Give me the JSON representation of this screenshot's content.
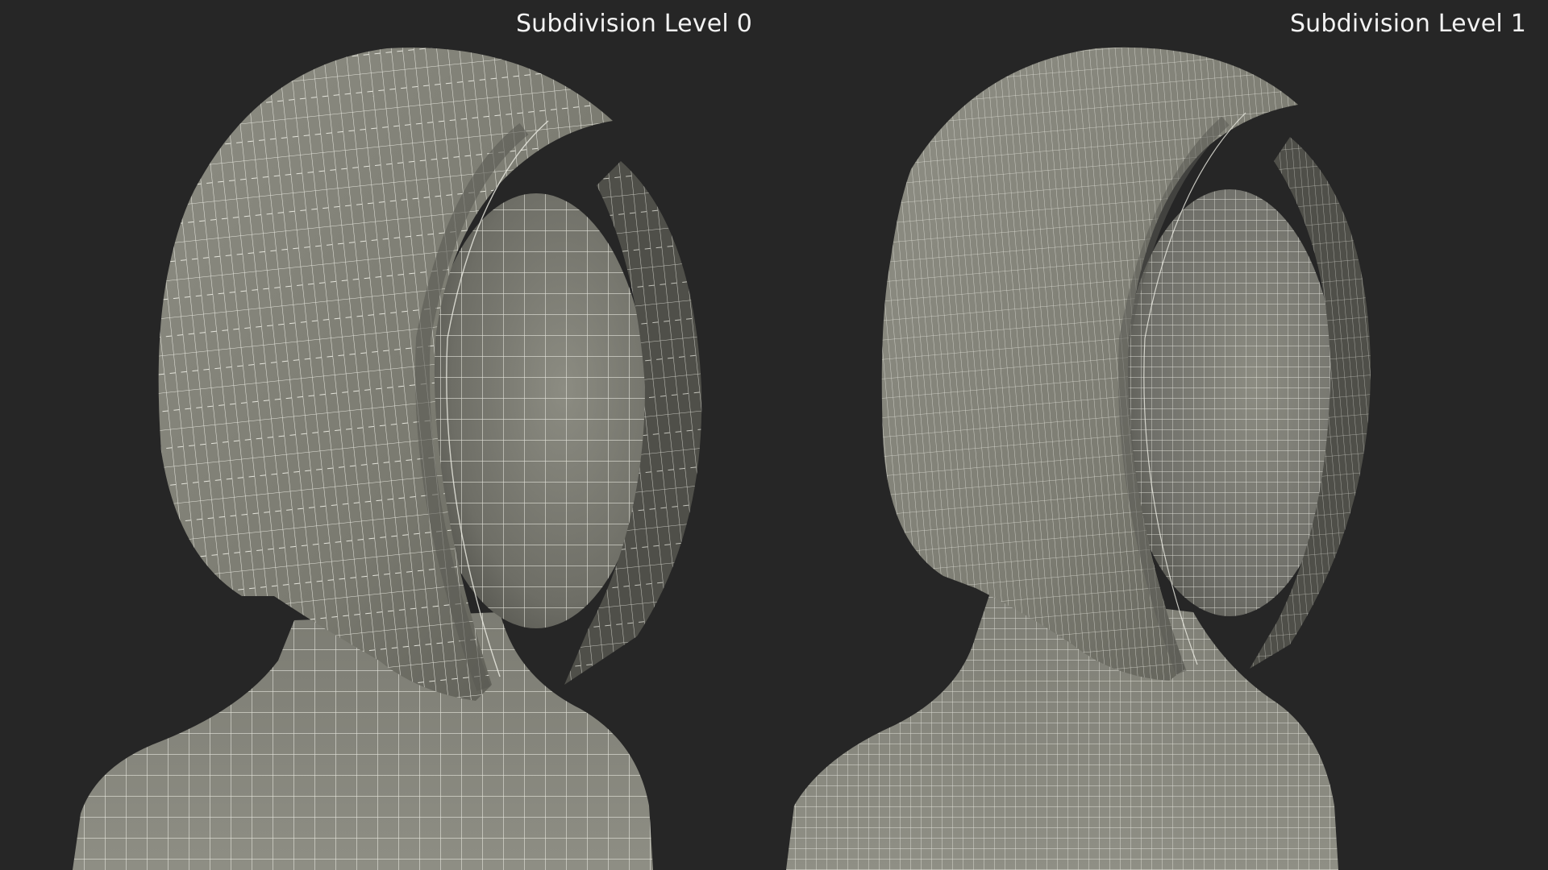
{
  "labels": {
    "left": "Subdivision Level 0",
    "right": "Subdivision Level 1"
  },
  "colors": {
    "background": "#262626",
    "mesh_fill": "#8a8a80",
    "mesh_fill_dark": "#5c5c54",
    "wire": "#efefe6",
    "label": "#f2f2f2"
  },
  "models": [
    {
      "name": "hair-bob-level-0",
      "wire_density": 1
    },
    {
      "name": "hair-bob-level-1",
      "wire_density": 2
    }
  ]
}
